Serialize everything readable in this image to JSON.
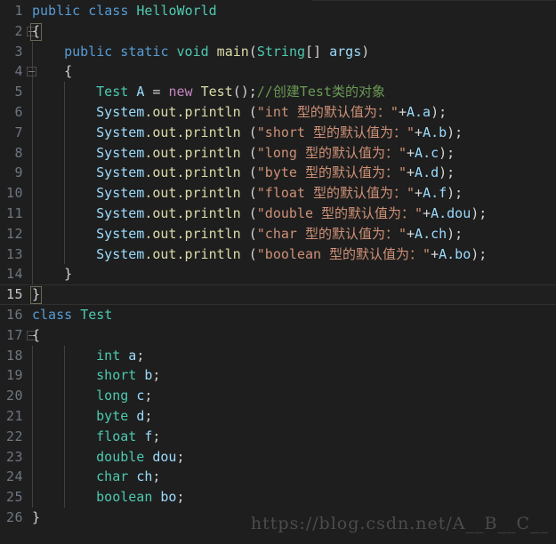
{
  "editor": {
    "theme_background": "#1e1e1e",
    "gutter_color": "#6e7681",
    "active_line_number_color": "#c6c6c6",
    "total_lines": 26,
    "active_line": 15,
    "colors": {
      "keyword": "#569cd6",
      "type": "#4ec9b0",
      "function": "#dcdcaa",
      "variable": "#9cdcfe",
      "string": "#ce9178",
      "comment": "#6a9955",
      "new_keyword": "#c586c0",
      "plain": "#d4d4d4"
    }
  },
  "line_numbers": [
    "1",
    "2",
    "3",
    "4",
    "5",
    "6",
    "7",
    "8",
    "9",
    "10",
    "11",
    "12",
    "13",
    "14",
    "15",
    "16",
    "17",
    "18",
    "19",
    "20",
    "21",
    "22",
    "23",
    "24",
    "25",
    "26"
  ],
  "fold_markers": [
    2,
    4,
    17
  ],
  "code_lines": [
    {
      "n": 1,
      "indent": 0,
      "text": "public class HelloWorld"
    },
    {
      "n": 2,
      "indent": 0,
      "text": "{"
    },
    {
      "n": 3,
      "indent": 1,
      "text": "public static void main(String[] args)"
    },
    {
      "n": 4,
      "indent": 1,
      "text": "{"
    },
    {
      "n": 5,
      "indent": 2,
      "text": "Test A = new Test();//创建Test类的对象"
    },
    {
      "n": 6,
      "indent": 2,
      "text": "System.out.println (\"int 型的默认值为：\"+A.a);"
    },
    {
      "n": 7,
      "indent": 2,
      "text": "System.out.println (\"short 型的默认值为：\"+A.b);"
    },
    {
      "n": 8,
      "indent": 2,
      "text": "System.out.println (\"long 型的默认值为：\"+A.c);"
    },
    {
      "n": 9,
      "indent": 2,
      "text": "System.out.println (\"byte 型的默认值为：\"+A.d);"
    },
    {
      "n": 10,
      "indent": 2,
      "text": "System.out.println (\"float 型的默认值为：\"+A.f);"
    },
    {
      "n": 11,
      "indent": 2,
      "text": "System.out.println (\"double 型的默认值为：\"+A.dou);"
    },
    {
      "n": 12,
      "indent": 2,
      "text": "System.out.println (\"char 型的默认值为：\"+A.ch);"
    },
    {
      "n": 13,
      "indent": 2,
      "text": "System.out.println (\"boolean 型的默认值为：\"+A.bo);"
    },
    {
      "n": 14,
      "indent": 1,
      "text": "}"
    },
    {
      "n": 15,
      "indent": 0,
      "text": "}"
    },
    {
      "n": 16,
      "indent": 0,
      "text": "class Test"
    },
    {
      "n": 17,
      "indent": 0,
      "text": "{"
    },
    {
      "n": 18,
      "indent": 2,
      "text": "int a;"
    },
    {
      "n": 19,
      "indent": 2,
      "text": "short b;"
    },
    {
      "n": 20,
      "indent": 2,
      "text": "long c;"
    },
    {
      "n": 21,
      "indent": 2,
      "text": "byte d;"
    },
    {
      "n": 22,
      "indent": 2,
      "text": "float f;"
    },
    {
      "n": 23,
      "indent": 2,
      "text": "double dou;"
    },
    {
      "n": 24,
      "indent": 2,
      "text": "char ch;"
    },
    {
      "n": 25,
      "indent": 2,
      "text": "boolean bo;"
    },
    {
      "n": 26,
      "indent": 0,
      "text": "}"
    }
  ],
  "tokens": {
    "l1": [
      [
        "public ",
        "kw"
      ],
      [
        "class ",
        "kw"
      ],
      [
        "HelloWorld",
        "type"
      ]
    ],
    "l2": [
      [
        "{",
        "plain"
      ]
    ],
    "l3": [
      [
        "public ",
        "kw"
      ],
      [
        "static ",
        "kw"
      ],
      [
        "void ",
        "type"
      ],
      [
        "main",
        "fn"
      ],
      [
        "(",
        "plain"
      ],
      [
        "String",
        "type"
      ],
      [
        "[] ",
        "plain"
      ],
      [
        "args",
        "var"
      ],
      [
        ")",
        "plain"
      ]
    ],
    "l4": [
      [
        "{",
        "plain"
      ]
    ],
    "l5": [
      [
        "Test ",
        "type"
      ],
      [
        "A",
        "var"
      ],
      [
        " = ",
        "plain"
      ],
      [
        "new ",
        "newkw"
      ],
      [
        "Test",
        "fn"
      ],
      [
        "();",
        "plain"
      ],
      [
        "//创建Test类的对象",
        "cmt"
      ]
    ],
    "l6": [
      [
        "System",
        "sys"
      ],
      [
        ".out.println",
        "fn"
      ],
      [
        " (",
        "plain"
      ],
      [
        "\"int 型的默认值为：\"",
        "str"
      ],
      [
        "+",
        "plain"
      ],
      [
        "A",
        "var"
      ],
      [
        ".a",
        "var"
      ],
      [
        ");",
        "plain"
      ]
    ],
    "l7": [
      [
        "System",
        "sys"
      ],
      [
        ".out.println",
        "fn"
      ],
      [
        " (",
        "plain"
      ],
      [
        "\"short 型的默认值为：\"",
        "str"
      ],
      [
        "+",
        "plain"
      ],
      [
        "A",
        "var"
      ],
      [
        ".b",
        "var"
      ],
      [
        ");",
        "plain"
      ]
    ],
    "l8": [
      [
        "System",
        "sys"
      ],
      [
        ".out.println",
        "fn"
      ],
      [
        " (",
        "plain"
      ],
      [
        "\"long 型的默认值为：\"",
        "str"
      ],
      [
        "+",
        "plain"
      ],
      [
        "A",
        "var"
      ],
      [
        ".c",
        "var"
      ],
      [
        ");",
        "plain"
      ]
    ],
    "l9": [
      [
        "System",
        "sys"
      ],
      [
        ".out.println",
        "fn"
      ],
      [
        " (",
        "plain"
      ],
      [
        "\"byte 型的默认值为：\"",
        "str"
      ],
      [
        "+",
        "plain"
      ],
      [
        "A",
        "var"
      ],
      [
        ".d",
        "var"
      ],
      [
        ");",
        "plain"
      ]
    ],
    "l10": [
      [
        "System",
        "sys"
      ],
      [
        ".out.println",
        "fn"
      ],
      [
        " (",
        "plain"
      ],
      [
        "\"float 型的默认值为：\"",
        "str"
      ],
      [
        "+",
        "plain"
      ],
      [
        "A",
        "var"
      ],
      [
        ".f",
        "var"
      ],
      [
        ");",
        "plain"
      ]
    ],
    "l11": [
      [
        "System",
        "sys"
      ],
      [
        ".out.println",
        "fn"
      ],
      [
        " (",
        "plain"
      ],
      [
        "\"double 型的默认值为：\"",
        "str"
      ],
      [
        "+",
        "plain"
      ],
      [
        "A",
        "var"
      ],
      [
        ".dou",
        "var"
      ],
      [
        ");",
        "plain"
      ]
    ],
    "l12": [
      [
        "System",
        "sys"
      ],
      [
        ".out.println",
        "fn"
      ],
      [
        " (",
        "plain"
      ],
      [
        "\"char 型的默认值为：\"",
        "str"
      ],
      [
        "+",
        "plain"
      ],
      [
        "A",
        "var"
      ],
      [
        ".ch",
        "var"
      ],
      [
        ");",
        "plain"
      ]
    ],
    "l13": [
      [
        "System",
        "sys"
      ],
      [
        ".out.println",
        "fn"
      ],
      [
        " (",
        "plain"
      ],
      [
        "\"boolean 型的默认值为：\"",
        "str"
      ],
      [
        "+",
        "plain"
      ],
      [
        "A",
        "var"
      ],
      [
        ".bo",
        "var"
      ],
      [
        ");",
        "plain"
      ]
    ],
    "l14": [
      [
        "}",
        "plain"
      ]
    ],
    "l15": [
      [
        "}",
        "plain"
      ]
    ],
    "l16": [
      [
        "class ",
        "kw"
      ],
      [
        "Test",
        "type"
      ]
    ],
    "l17": [
      [
        "{",
        "plain"
      ]
    ],
    "l18": [
      [
        "int ",
        "type"
      ],
      [
        "a",
        "var"
      ],
      [
        ";",
        "plain"
      ]
    ],
    "l19": [
      [
        "short ",
        "type"
      ],
      [
        "b",
        "var"
      ],
      [
        ";",
        "plain"
      ]
    ],
    "l20": [
      [
        "long ",
        "type"
      ],
      [
        "c",
        "var"
      ],
      [
        ";",
        "plain"
      ]
    ],
    "l21": [
      [
        "byte ",
        "type"
      ],
      [
        "d",
        "var"
      ],
      [
        ";",
        "plain"
      ]
    ],
    "l22": [
      [
        "float ",
        "type"
      ],
      [
        "f",
        "var"
      ],
      [
        ";",
        "plain"
      ]
    ],
    "l23": [
      [
        "double ",
        "type"
      ],
      [
        "dou",
        "var"
      ],
      [
        ";",
        "plain"
      ]
    ],
    "l24": [
      [
        "char ",
        "type"
      ],
      [
        "ch",
        "var"
      ],
      [
        ";",
        "plain"
      ]
    ],
    "l25": [
      [
        "boolean ",
        "type"
      ],
      [
        "bo",
        "var"
      ],
      [
        ";",
        "plain"
      ]
    ],
    "l26": [
      [
        "}",
        "plain"
      ]
    ]
  },
  "watermark": {
    "text": "https://blog.csdn.net/A__B__C__"
  }
}
